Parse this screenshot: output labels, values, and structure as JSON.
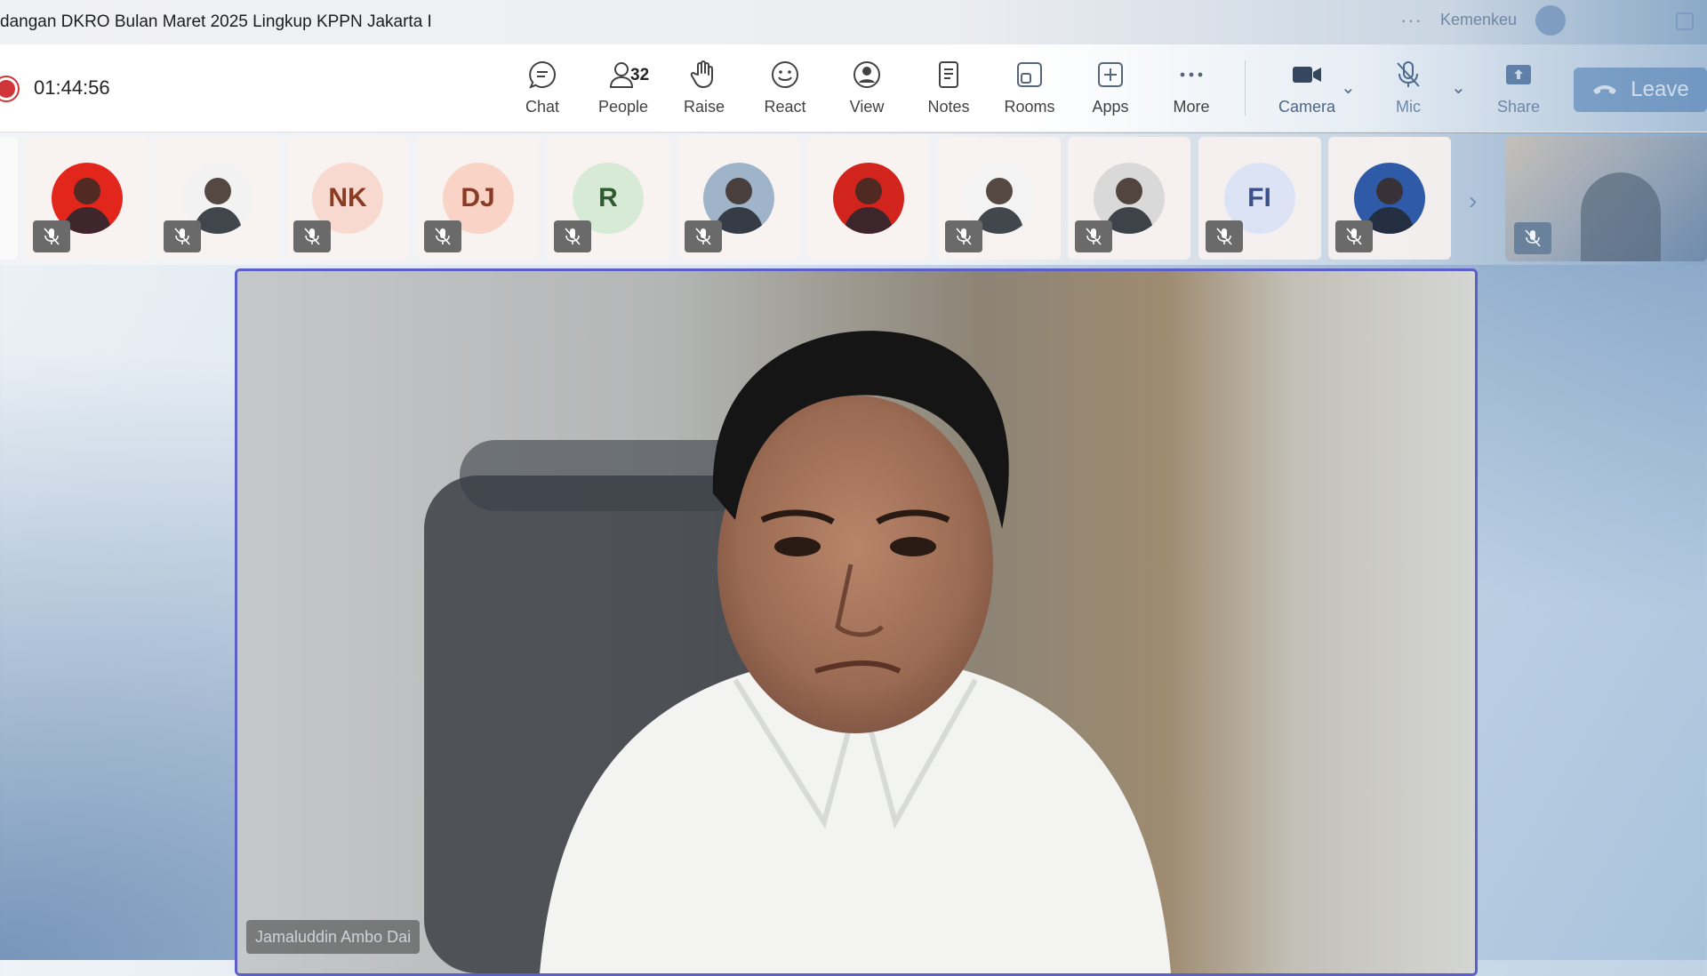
{
  "window": {
    "title": "dangan DKRO Bulan Maret 2025 Lingkup KPPN Jakarta I",
    "org": "Kemenkeu",
    "more_glyph": "···"
  },
  "toolbar": {
    "timer": "01:44:56",
    "chat": "Chat",
    "people": "People",
    "people_count": "32",
    "raise": "Raise",
    "react": "React",
    "view": "View",
    "notes": "Notes",
    "rooms": "Rooms",
    "apps": "Apps",
    "more": "More",
    "camera": "Camera",
    "mic": "Mic",
    "share": "Share",
    "leave": "Leave"
  },
  "participants": [
    {
      "kind": "photo",
      "icon": "avatar-photo",
      "muted": true,
      "bg": "#e2261c"
    },
    {
      "kind": "photo",
      "icon": "avatar-photo",
      "muted": true,
      "bg": "#f2f2f2"
    },
    {
      "kind": "initials",
      "initials": "NK",
      "muted": true,
      "bg": "#f7d9cf",
      "fg": "#8a3b24"
    },
    {
      "kind": "initials",
      "initials": "DJ",
      "muted": true,
      "bg": "#f8d3c6",
      "fg": "#8a3b24"
    },
    {
      "kind": "initials",
      "initials": "R",
      "muted": true,
      "bg": "#d7ead6",
      "fg": "#2f5b2f"
    },
    {
      "kind": "photo",
      "icon": "avatar-photo",
      "muted": true,
      "bg": "#9fb3c9"
    },
    {
      "kind": "photo",
      "icon": "avatar-photo",
      "muted": false,
      "bg": "#d1241c"
    },
    {
      "kind": "photo",
      "icon": "avatar-photo",
      "muted": true,
      "bg": "#f3f3f3"
    },
    {
      "kind": "photo",
      "icon": "avatar-photo",
      "muted": true,
      "bg": "#d9d9d9"
    },
    {
      "kind": "initials",
      "initials": "FI",
      "muted": true,
      "bg": "#dbe3f5",
      "fg": "#3b4f8a"
    },
    {
      "kind": "photo",
      "icon": "avatar-photo",
      "muted": true,
      "bg": "#2e5aa8"
    }
  ],
  "speaker": {
    "name": "Jamaluddin Ambo Dai"
  },
  "colors": {
    "accent": "#5b5fc7",
    "recording": "#d13438"
  }
}
